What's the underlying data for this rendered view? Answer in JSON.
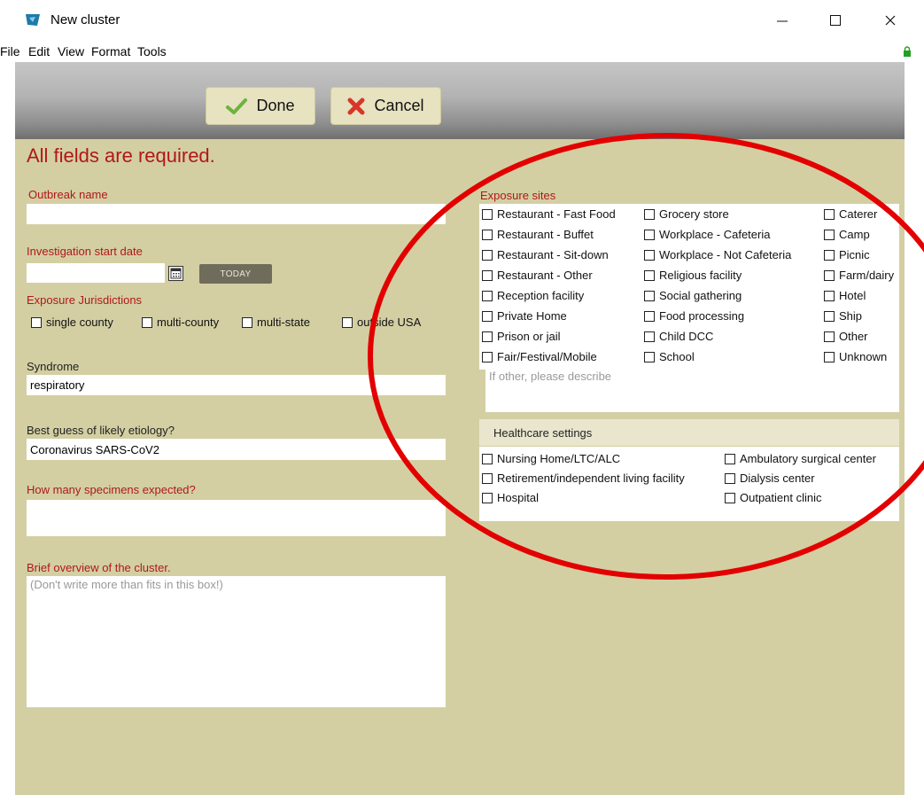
{
  "window": {
    "title": "New cluster",
    "controls": {
      "minimize": "—",
      "maximize": "☐",
      "close": "✕"
    }
  },
  "menu": {
    "items": [
      "File",
      "Edit",
      "View",
      "Format",
      "Tools"
    ]
  },
  "toolbar": {
    "done_label": "Done",
    "cancel_label": "Cancel"
  },
  "form": {
    "required_notice": "All fields are required.",
    "outbreak_name": {
      "label": "Outbreak name",
      "value": ""
    },
    "investigation_start_date": {
      "label": "Investigation start date",
      "value": "",
      "today_label": "TODAY"
    },
    "exposure_jurisdictions": {
      "label": "Exposure Jurisdictions",
      "options": [
        "single county",
        "multi-county",
        "multi-state",
        "outside USA"
      ]
    },
    "syndrome": {
      "label": "Syndrome",
      "value": "respiratory"
    },
    "etiology": {
      "label": "Best guess of likely etiology?",
      "value": "Coronavirus SARS-CoV2"
    },
    "specimens": {
      "label": "How many specimens expected?",
      "value": ""
    },
    "overview": {
      "label": "Brief overview of the cluster.",
      "placeholder": "(Don't write more than fits in this box!)"
    },
    "exposure_sites": {
      "label": "Exposure sites",
      "col1": [
        "Restaurant - Fast Food",
        "Restaurant - Buffet",
        "Restaurant - Sit-down",
        "Restaurant - Other",
        "Reception facility",
        "Private Home",
        "Prison or jail",
        "Fair/Festival/Mobile"
      ],
      "col2": [
        "Grocery store",
        "Workplace - Cafeteria",
        "Workplace - Not Cafeteria",
        "Religious facility",
        "Social gathering",
        "Food processing",
        "Child DCC",
        "School"
      ],
      "col3": [
        "Caterer",
        "Camp",
        "Picnic",
        "Farm/dairy",
        "Hotel",
        "Ship",
        "Other",
        "Unknown"
      ],
      "other_placeholder": "If other, please describe"
    },
    "healthcare_settings": {
      "label": "Healthcare settings",
      "col1": [
        "Nursing Home/LTC/ALC",
        "Retirement/independent living facility",
        "Hospital"
      ],
      "col2": [
        "Ambulatory surgical center",
        "Dialysis center",
        "Outpatient clinic"
      ]
    }
  },
  "colors": {
    "panel_bg": "#d3cfa3",
    "label_red": "#b01818",
    "button_bg": "#e7e2bf",
    "annotation_red": "#e30000"
  }
}
